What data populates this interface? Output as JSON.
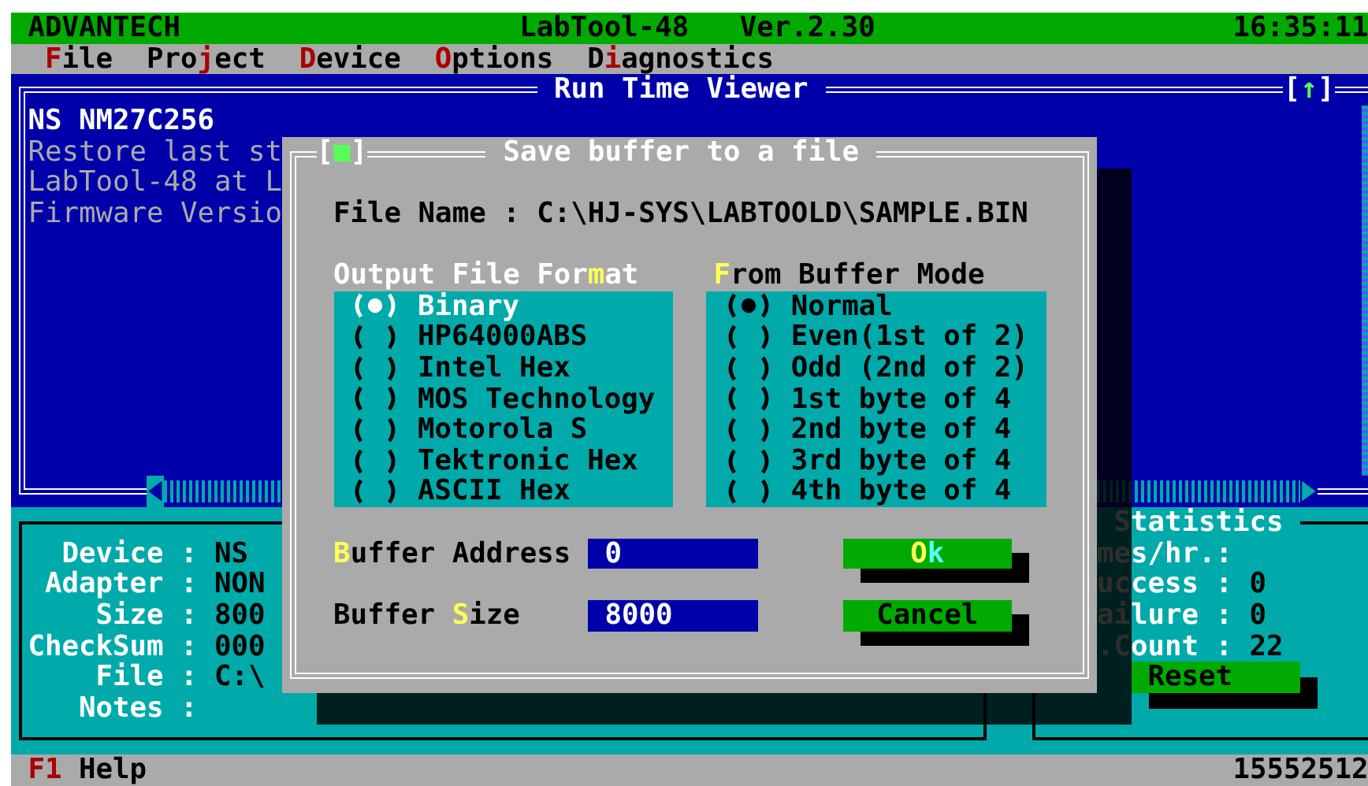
{
  "title_bar": {
    "brand": "ADVANTECH",
    "app_name": "LabTool-48",
    "version": "Ver.2.30",
    "time": "16:35:11"
  },
  "menu": [
    {
      "key": "F",
      "post": "ile"
    },
    {
      "pre": "Pro",
      "key": "j",
      "post": "ect"
    },
    {
      "key": "D",
      "post": "evice"
    },
    {
      "key": "O",
      "post": "ptions"
    },
    {
      "pre": "D",
      "key": "i",
      "post": "agnostics"
    }
  ],
  "viewer": {
    "title": "Run Time Viewer",
    "scroll_button": {
      "pre": "[",
      "key": "↑",
      "post": "]"
    },
    "lines": [
      {
        "text": "NS NM27C256",
        "bright": true
      },
      {
        "text": "Restore last st",
        "bright": false
      },
      {
        "text": "LabTool-48 at L",
        "bright": false
      },
      {
        "text": "Firmware Versio",
        "bright": false
      }
    ]
  },
  "device_info": [
    {
      "label": "Device :",
      "value": "NS"
    },
    {
      "label": "Adapter :",
      "value": "NON"
    },
    {
      "label": "Size :",
      "value": "800"
    },
    {
      "label": "CheckSum :",
      "value": "000"
    },
    {
      "label": "File :",
      "value": "C:\\"
    },
    {
      "label": "Notes :"
    }
  ],
  "statistics": {
    "title": "Statistics",
    "rows": [
      {
        "label": "mes/hr.:"
      },
      {
        "label": "uccess :",
        "value": "0"
      },
      {
        "label": "ailure :",
        "value": "0"
      },
      {
        "label": ".Count :",
        "value": "22"
      }
    ],
    "reset": "Reset"
  },
  "dialog": {
    "close": {
      "pre": "[",
      "key": "■",
      "post": "]"
    },
    "title": "Save buffer to a file",
    "file_label": "File Name :",
    "file_value": "C:\\HJ-SYS\\LABTOOLD\\SAMPLE.BIN",
    "groups": [
      {
        "header": {
          "pre": "Output File For",
          "key": "m",
          "post": "at"
        },
        "focused": true,
        "options": [
          {
            "label": "Binary",
            "selected": true
          },
          {
            "label": "HP64000ABS",
            "selected": false
          },
          {
            "label": "Intel Hex",
            "selected": false
          },
          {
            "label": "MOS Technology",
            "selected": false
          },
          {
            "label": "Motorola S",
            "selected": false
          },
          {
            "label": "Tektronic Hex",
            "selected": false
          },
          {
            "label": "ASCII Hex",
            "selected": false
          }
        ]
      },
      {
        "header": {
          "key": "F",
          "post": "rom Buffer Mode"
        },
        "focused": false,
        "options": [
          {
            "label": "Normal",
            "selected": true
          },
          {
            "label": "Even(1st of 2)",
            "selected": false
          },
          {
            "label": "Odd (2nd of 2)",
            "selected": false
          },
          {
            "label": "1st byte of 4",
            "selected": false
          },
          {
            "label": "2nd byte of 4",
            "selected": false
          },
          {
            "label": "3rd byte of 4",
            "selected": false
          },
          {
            "label": "4th byte of 4",
            "selected": false
          }
        ]
      }
    ],
    "fields": [
      {
        "label": {
          "key": "B",
          "post": "uffer Address"
        },
        "value": "0"
      },
      {
        "label": {
          "pre": "Buffer ",
          "key": "S",
          "post": "ize"
        },
        "value": "8000"
      }
    ],
    "buttons": [
      {
        "key": "O",
        "post": "k",
        "focused": true
      },
      {
        "label": "Cancel",
        "focused": false
      }
    ]
  },
  "status_bar": {
    "key": "F1",
    "label": "Help",
    "memory": "15552512"
  }
}
